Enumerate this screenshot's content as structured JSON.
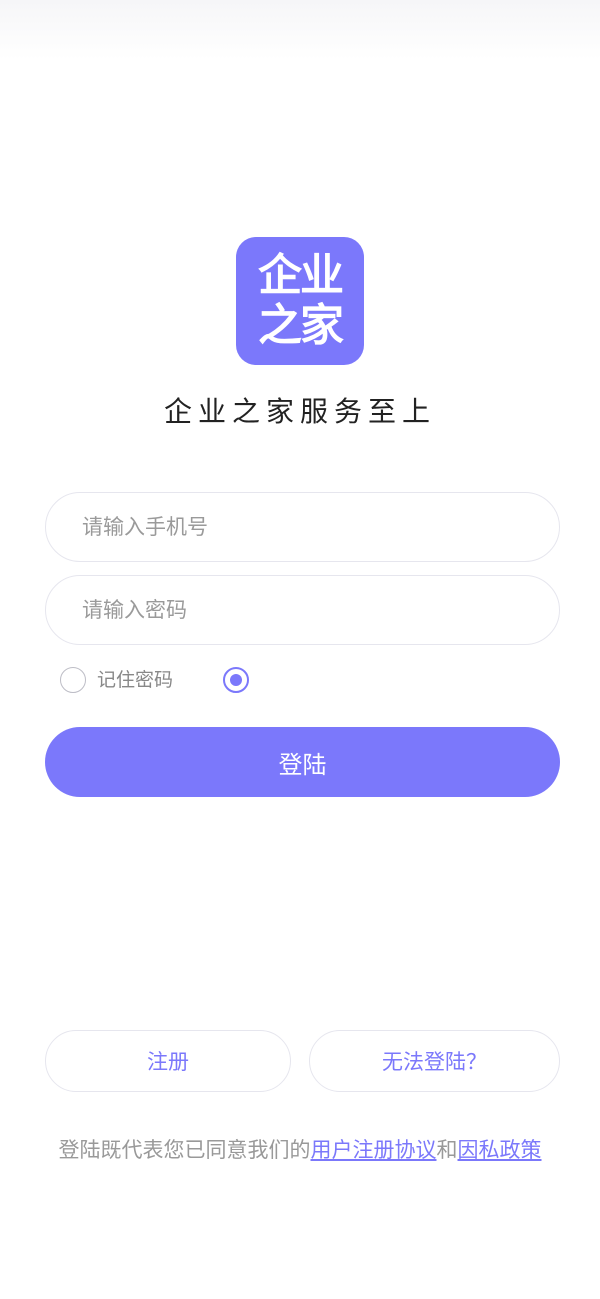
{
  "logo": {
    "line1": "企业",
    "line2": "之家"
  },
  "slogan": "企业之家服务至上",
  "form": {
    "phone_placeholder": "请输入手机号",
    "password_placeholder": "请输入密码",
    "remember_label": "记住密码",
    "remember_checked": false,
    "agree_checked": true,
    "login_label": "登陆"
  },
  "actions": {
    "register_label": "注册",
    "cannot_login_label": "无法登陆？"
  },
  "agreement": {
    "prefix": "登陆既代表您已同意我们的",
    "user_agreement": "用户注册协议",
    "and": "和",
    "privacy_policy": "因私政策"
  },
  "colors": {
    "accent": "#7b78fb",
    "border": "#e6e6ee",
    "placeholder": "#9a9a9a"
  }
}
